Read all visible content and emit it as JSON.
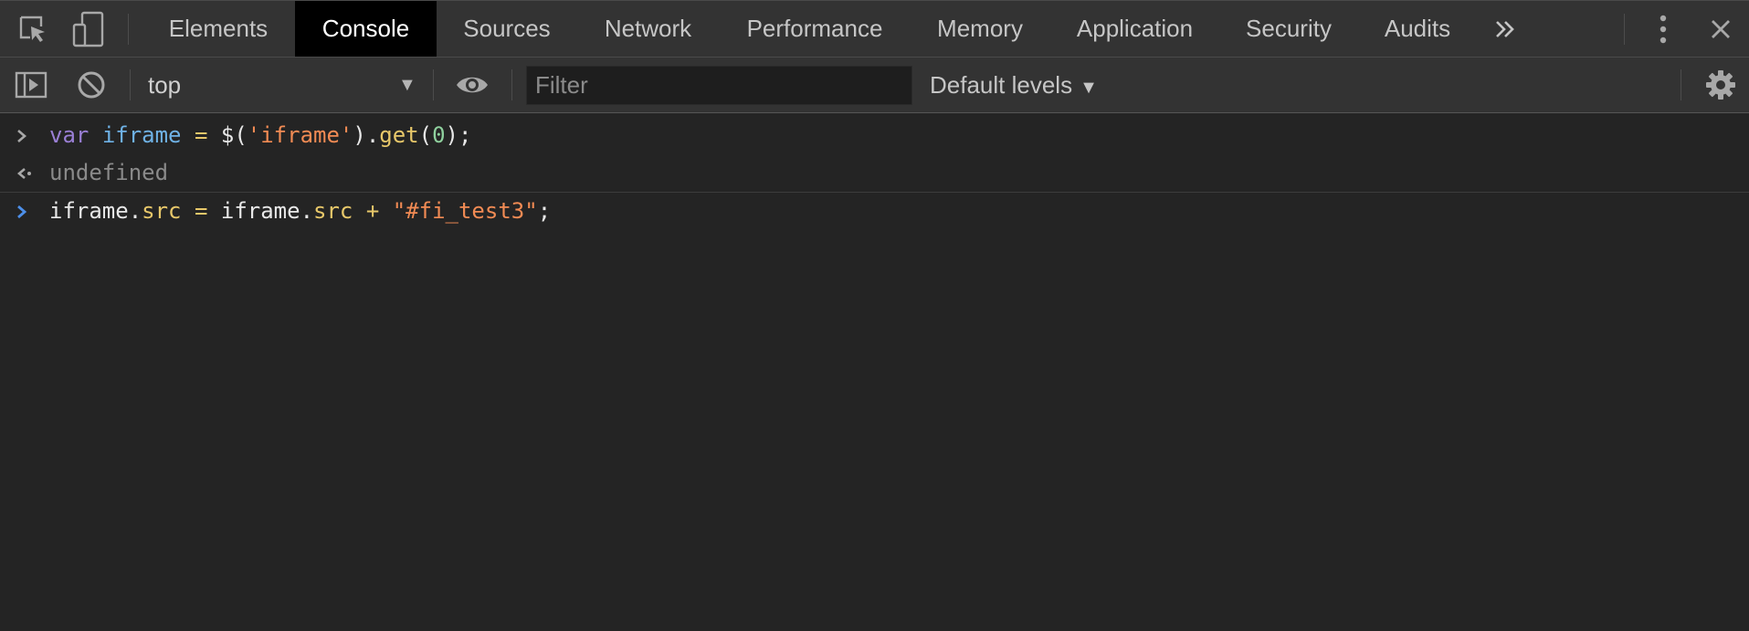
{
  "tabbar": {
    "tabs": [
      {
        "label": "Elements"
      },
      {
        "label": "Console",
        "active": true
      },
      {
        "label": "Sources"
      },
      {
        "label": "Network"
      },
      {
        "label": "Performance"
      },
      {
        "label": "Memory"
      },
      {
        "label": "Application"
      },
      {
        "label": "Security"
      },
      {
        "label": "Audits"
      }
    ],
    "overflow_icon": "double-chevron-right-icon",
    "menu_icon": "kebab-menu-icon",
    "close_icon": "close-icon"
  },
  "toolbar": {
    "context": "top",
    "filter_placeholder": "Filter",
    "levels_label": "Default levels"
  },
  "console": {
    "entry1": {
      "t1": "var",
      "t2": " ",
      "t3": "iframe",
      "t4": " ",
      "t5": "=",
      "t6": " $(",
      "t7": "'iframe'",
      "t8": ").",
      "t9": "get",
      "t10": "(",
      "t11": "0",
      "t12": ");"
    },
    "result1": "undefined",
    "entry2": {
      "t1": "iframe.",
      "t2": "src",
      "t3": " ",
      "t4": "=",
      "t5": " iframe.",
      "t6": "src",
      "t7": " ",
      "t8": "+",
      "t9": " ",
      "t10": "\"#fi_test3\"",
      "t11": ";"
    }
  },
  "colors": {
    "accent": "#4d8fe9",
    "background": "#242424",
    "toolbar": "#333333"
  }
}
